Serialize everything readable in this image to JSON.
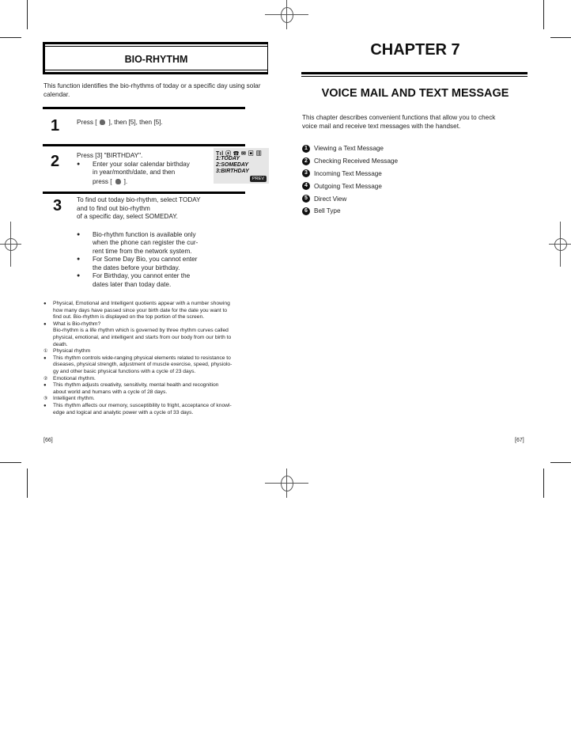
{
  "left_page": {
    "title": "BIO-RHYTHM",
    "intro": "This function identifies the bio-rhythms of today or a specific day using solar calendar.",
    "steps": [
      {
        "number": "1",
        "text_before_key": "Press [",
        "key_icon": "menu-key-icon",
        "text_after_key": "], then [5], then [5]."
      },
      {
        "number": "2",
        "line1": "Press [3] \"BIRTHDAY\".",
        "bullet_line1": "Enter your solar calendar birthday",
        "bullet_line2": "in year/month/date, and then",
        "bullet_line3_before": "press [",
        "bullet_line3_after": "].",
        "screen": {
          "status_icons": "Tıl ⓔ ☎   ✉ ▣ ▥",
          "items": [
            "1:TODAY",
            "2:SOMEDAY",
            "3:BIRTHDAY"
          ],
          "soft_key": "PREV"
        }
      },
      {
        "number": "3",
        "lines": [
          "To find out today bio-rhythm, select TODAY",
          "and to find out bio-rhythm",
          "of a specific day, select SOMEDAY."
        ],
        "bullets": [
          [
            "Bio-rhythm function is available only",
            "when the phone can register the cur-",
            "rent time from the network system."
          ],
          [
            "For Some Day Bio, you cannot enter",
            "the dates before your birthday."
          ],
          [
            "For Birthday, you cannot enter the",
            "dates later than today date."
          ]
        ]
      }
    ],
    "notes": [
      {
        "marker": "●",
        "lines": [
          "Physical, Emotional and Intelligent quotients appear with a number showing",
          "how many days have passed since your birth date for the date you want to",
          "find out. Bio-rhythm is displayed on the top portion of the screen."
        ]
      },
      {
        "marker": "●",
        "lines": [
          "What is Bio-rhythm?",
          "Bio-rhythm is a life rhythm which is governed by three rhythm curves called",
          "physical, emotional, and intelligent and starts from our body from our birth to",
          "death."
        ]
      },
      {
        "marker": "①",
        "lines": [
          "Physical rhythm"
        ]
      },
      {
        "marker": "●",
        "lines": [
          "This rhythm controls wide-ranging physical elements related to resistance to",
          "diseases, physical strength, adjustment of muscle exercise, speed, physiolo-",
          "gy and other basic physical functions with a cycle of 23 days."
        ]
      },
      {
        "marker": "②",
        "lines": [
          "Emotional rhythm."
        ]
      },
      {
        "marker": "●",
        "lines": [
          "This rhythm adjusts creativity, sensitivity, mental health and recognition",
          "about world and humans with a cycle of 28 days."
        ]
      },
      {
        "marker": "③",
        "lines": [
          "Intelligent rhythm."
        ]
      },
      {
        "marker": "●",
        "lines": [
          "This rhythm affects our memory, susceptibility to fright, acceptance of knowl-",
          "edge and logical and analytic power with a cycle of 33 days."
        ]
      }
    ],
    "page_number": "[66]"
  },
  "right_page": {
    "chapter": "CHAPTER 7",
    "title": "VOICE MAIL AND TEXT MESSAGE",
    "intro_line1": "This chapter describes convenient functions that allow you to check",
    "intro_line2": "voice mail and receive text messages with the handset.",
    "toc": [
      {
        "num": "1",
        "label": "Viewing a Text Message"
      },
      {
        "num": "2",
        "label": "Checking Received Message"
      },
      {
        "num": "3",
        "label": "Incoming Text Message"
      },
      {
        "num": "4",
        "label": "Outgoing Text Message"
      },
      {
        "num": "5",
        "label": "Direct View"
      },
      {
        "num": "6",
        "label": "Bell Type"
      }
    ],
    "page_number": "[67]"
  }
}
